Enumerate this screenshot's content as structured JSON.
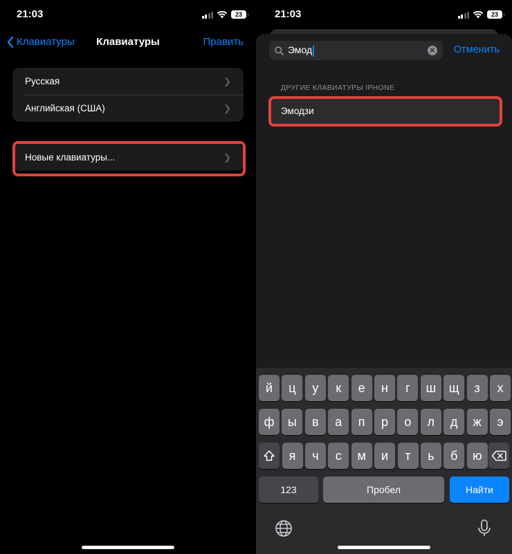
{
  "left": {
    "status": {
      "time": "21:03",
      "battery": "23"
    },
    "nav": {
      "back_label": "Клавиатуры",
      "title": "Клавиатуры",
      "edit_label": "Править"
    },
    "keyboards": [
      {
        "label": "Русская"
      },
      {
        "label": "Английская (США)"
      }
    ],
    "add_keyboard": {
      "label": "Новые клавиатуры..."
    }
  },
  "right": {
    "status": {
      "time": "21:03",
      "battery": "23"
    },
    "search": {
      "value": "Эмод",
      "cancel_label": "Отменить"
    },
    "section_header": "ДРУГИЕ КЛАВИАТУРЫ IPHONE",
    "result": {
      "label": "Эмодзи"
    },
    "keyboard": {
      "row1": [
        "й",
        "ц",
        "у",
        "к",
        "е",
        "н",
        "г",
        "ш",
        "щ",
        "з",
        "х"
      ],
      "row2": [
        "ф",
        "ы",
        "в",
        "а",
        "п",
        "р",
        "о",
        "л",
        "д",
        "ж",
        "э"
      ],
      "row3": [
        "я",
        "ч",
        "с",
        "м",
        "и",
        "т",
        "ь",
        "б",
        "ю"
      ],
      "numbers_label": "123",
      "space_label": "Пробел",
      "go_label": "Найти"
    }
  },
  "colors": {
    "accent": "#0a84ff",
    "highlight": "#e0443a",
    "cell_bg": "#1c1c1e"
  },
  "icons": [
    "chevron-left-icon",
    "chevron-right-icon",
    "search-icon",
    "clear-icon",
    "shift-icon",
    "delete-icon",
    "globe-icon",
    "microphone-icon",
    "wifi-icon",
    "cellular-signal-icon",
    "battery-icon"
  ]
}
